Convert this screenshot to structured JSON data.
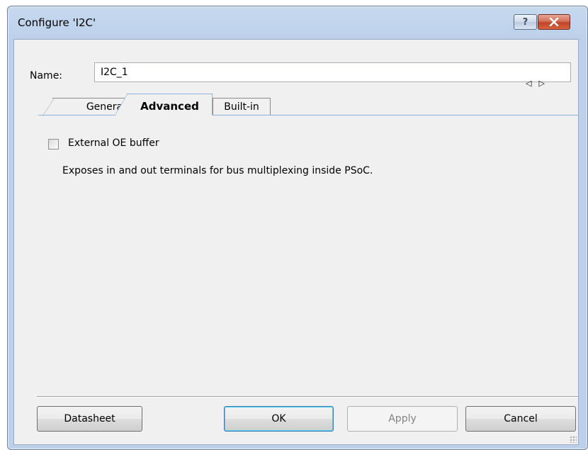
{
  "window": {
    "title": "Configure 'I2C'"
  },
  "caption_buttons": {
    "help_symbol": "?",
    "close_icon": "close-icon"
  },
  "name_field": {
    "label": "Name:",
    "value": "I2C_1"
  },
  "tabs": [
    {
      "label": "General",
      "selected": false
    },
    {
      "label": "Advanced",
      "selected": true
    },
    {
      "label": "Built-in",
      "selected": false
    }
  ],
  "tab_scroll": {
    "left_symbol": "◁",
    "right_symbol": "▷"
  },
  "advanced": {
    "external_oe_buffer": {
      "label": "External OE buffer",
      "checked": false
    },
    "description": "Exposes in and out terminals for bus multiplexing inside PSoC."
  },
  "buttons": {
    "datasheet": "Datasheet",
    "ok": "OK",
    "apply": "Apply",
    "cancel": "Cancel"
  },
  "colors": {
    "titlebar": "#bcd0ea",
    "client_bg": "#f0f0f0",
    "close_button": "#c1442a",
    "tab_border_selected": "#8eb2e0"
  }
}
